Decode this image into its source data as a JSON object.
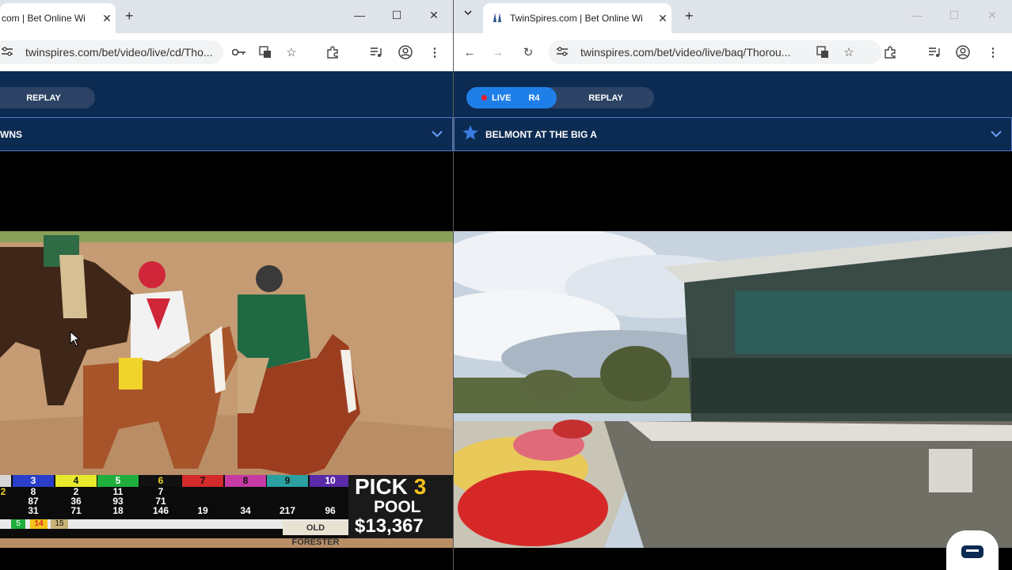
{
  "left_window": {
    "tab_title": "com | Bet Online Wi",
    "url": "twinspires.com/bet/video/live/cd/Tho...",
    "replay_label": "REPLAY",
    "track_name": "WNS",
    "odds_board": {
      "columns": [
        {
          "num": "",
          "color": "#d7d7d7",
          "cells": [
            "2",
            "",
            "",
            ""
          ]
        },
        {
          "num": "3",
          "color": "#2b3ec9",
          "cells": [
            "8",
            "87",
            "31"
          ]
        },
        {
          "num": "4",
          "color": "#e8e82c",
          "cells": [
            "2",
            "36",
            "71"
          ]
        },
        {
          "num": "5",
          "color": "#1fae3c",
          "cells": [
            "11",
            "93",
            "18"
          ]
        },
        {
          "num": "6",
          "color": "#111111",
          "cells": [
            "7",
            "71",
            "146"
          ]
        },
        {
          "num": "7",
          "color": "#d32a2a",
          "cells": [
            "",
            "",
            "19"
          ]
        },
        {
          "num": "8",
          "color": "#c63aa3",
          "cells": [
            "",
            "",
            "34"
          ]
        },
        {
          "num": "9",
          "color": "#2aa0a0",
          "cells": [
            "",
            "",
            "217"
          ]
        },
        {
          "num": "10",
          "color": "#5a2aa8",
          "cells": [
            "",
            "",
            "96"
          ]
        }
      ],
      "order_strip": [
        "5",
        "14",
        "15"
      ],
      "sponsor": "OLD FORESTER"
    },
    "pick_title": "PICK",
    "pick_number": "3",
    "pool_label": "POOL",
    "pool_amount": "$13,367"
  },
  "right_window": {
    "tab_title": "TwinSpires.com | Bet Online Wi",
    "url": "twinspires.com/bet/video/live/baq/Thorou...",
    "live_label": "LIVE",
    "race_label": "R4",
    "replay_label": "REPLAY",
    "track_name": "BELMONT AT THE BIG A"
  },
  "colors": {
    "navy": "#0c2b52",
    "live_blue": "#1f7fe8",
    "live_dot": "#e8202a",
    "pick_yellow": "#f3c21b"
  },
  "icons": [
    "close-icon",
    "plus-icon",
    "minimize-icon",
    "maximize-icon",
    "key-icon",
    "translate-icon",
    "star-icon",
    "extensions-icon",
    "media-icon",
    "profile-icon",
    "menu-icon",
    "back-icon",
    "forward-icon",
    "reload-icon",
    "site-settings-icon",
    "chevron-down-icon",
    "chat-icon"
  ]
}
